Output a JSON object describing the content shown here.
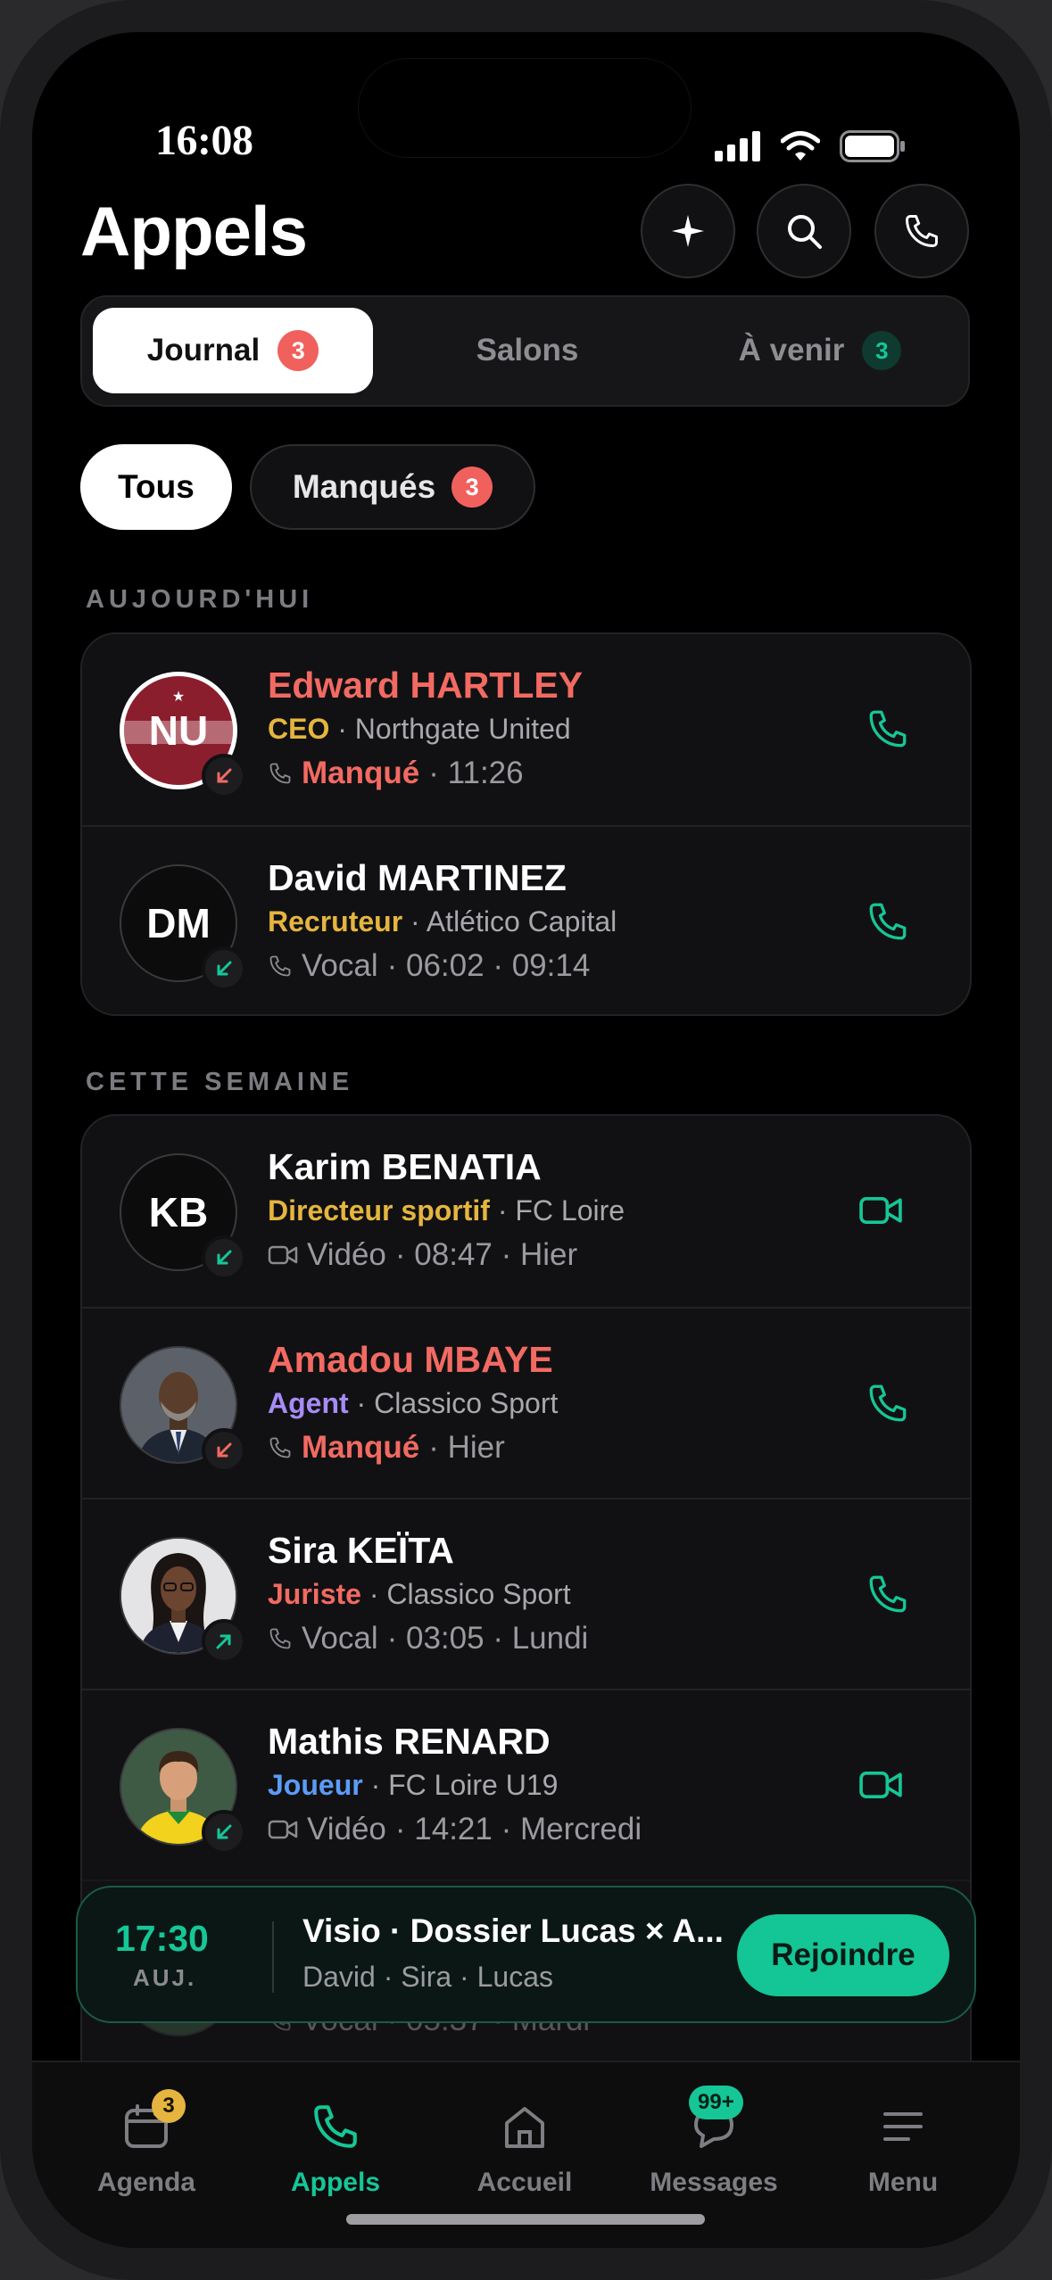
{
  "status_bar": {
    "time": "16:08"
  },
  "header": {
    "title": "Appels"
  },
  "segments": [
    {
      "label": "Journal",
      "badge": "3"
    },
    {
      "label": "Salons"
    },
    {
      "label": "À venir",
      "badge": "3"
    }
  ],
  "filters": [
    {
      "label": "Tous"
    },
    {
      "label": "Manqués",
      "badge": "3"
    }
  ],
  "sections": [
    {
      "title": "AUJOURD'HUI",
      "items": [
        {
          "initials": "NU",
          "name": "Edward HARTLEY",
          "role": "CEO",
          "org": "· Northgate United",
          "kind": "Manqué",
          "details": "· 11:26"
        },
        {
          "initials": "DM",
          "name": "David MARTINEZ",
          "role": "Recruteur",
          "org": "· Atlético Capital",
          "kind": "Vocal",
          "details": "· 06:02 · 09:14"
        }
      ]
    },
    {
      "title": "CETTE SEMAINE",
      "items": [
        {
          "initials": "KB",
          "name": "Karim BENATIA",
          "role": "Directeur sportif",
          "org": "· FC Loire",
          "kind": "Vidéo",
          "details": "· 08:47 · Hier"
        },
        {
          "initials": "",
          "name": "Amadou MBAYE",
          "role": "Agent",
          "org": "· Classico Sport",
          "kind": "Manqué",
          "details": "· Hier"
        },
        {
          "initials": "",
          "name": "Sira KEÏTA",
          "role": "Juriste",
          "org": "· Classico Sport",
          "kind": "Vocal",
          "details": "· 03:05 · Lundi"
        },
        {
          "initials": "",
          "name": "Mathis RENARD",
          "role": "Joueur",
          "org": "· FC Loire U19",
          "kind": "Vidéo",
          "details": "· 14:21 · Mercredi"
        },
        {
          "name": "",
          "kind": "Vocal",
          "details": "· 05:37 · Mardi"
        }
      ]
    }
  ],
  "banner": {
    "time": "17:30",
    "day": "AUJ.",
    "title": "Visio · Dossier Lucas × A...",
    "subtitle": "David · Sira · Lucas",
    "button": "Rejoindre"
  },
  "tabbar": [
    {
      "label": "Agenda",
      "badge": "3"
    },
    {
      "label": "Appels"
    },
    {
      "label": "Accueil"
    },
    {
      "label": "Messages",
      "badge": "99+"
    },
    {
      "label": "Menu"
    }
  ],
  "colors": {
    "accent": "#16C697",
    "missed": "#F26A62",
    "role_gold": "#E5B53F",
    "role_purple": "#A78BF5",
    "role_red": "#F26A62",
    "role_blue": "#5B9CF5",
    "club_maroon": "#8B1E2D"
  },
  "icons": [
    "sparkle-icon",
    "search-icon",
    "phone-icon",
    "video-icon",
    "incoming-arrow-icon",
    "outgoing-arrow-icon",
    "calendar-icon",
    "home-icon",
    "chat-icon",
    "menu-icon"
  ]
}
